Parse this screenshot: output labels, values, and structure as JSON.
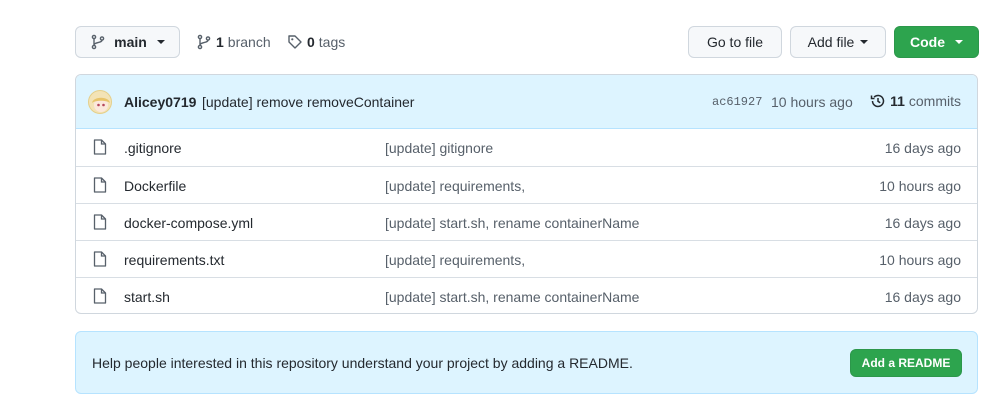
{
  "toolbar": {
    "branch_name": "main",
    "branch_count": "1",
    "branch_label": "branch",
    "tag_count": "0",
    "tag_label": "tags",
    "go_to_file_label": "Go to file",
    "add_file_label": "Add file",
    "code_label": "Code"
  },
  "commit": {
    "author": "Alicey0719",
    "message": "[update] remove removeContainer",
    "hash": "ac61927",
    "time": "10 hours ago",
    "commit_count": "11",
    "commit_label": "commits"
  },
  "files": [
    {
      "name": ".gitignore",
      "message": "[update] gitignore",
      "age": "16 days ago"
    },
    {
      "name": "Dockerfile",
      "message": "[update] requirements,",
      "age": "10 hours ago"
    },
    {
      "name": "docker-compose.yml",
      "message": "[update] start.sh, rename containerName",
      "age": "16 days ago"
    },
    {
      "name": "requirements.txt",
      "message": "[update] requirements,",
      "age": "10 hours ago"
    },
    {
      "name": "start.sh",
      "message": "[update] start.sh, rename containerName",
      "age": "16 days ago"
    }
  ],
  "readme": {
    "text": "Help people interested in this repository understand your project by adding a README.",
    "button_label": "Add a README"
  },
  "colors": {
    "primary_green": "#2da44e",
    "info_bg": "#ddf4ff",
    "border": "#d0d7de"
  }
}
